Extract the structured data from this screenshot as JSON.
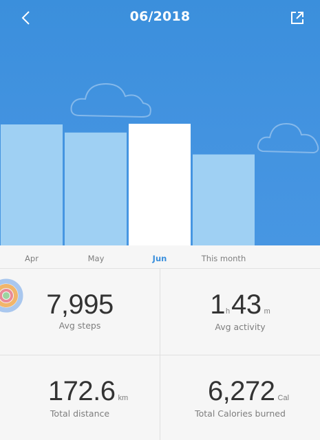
{
  "header": {
    "title": "06/2018",
    "back_icon": "chevron-left-icon",
    "share_icon": "share-external-icon"
  },
  "chart_data": {
    "type": "bar",
    "categories": [
      "Apr",
      "May",
      "Jun",
      "This month"
    ],
    "values": [
      7020,
      6550,
      7060,
      5280
    ],
    "selected_index": 2,
    "colors": {
      "bar": "#9fd0f3",
      "selected": "#ffffff",
      "background": "#3f91de"
    }
  },
  "tabs": [
    {
      "label": "Apr"
    },
    {
      "label": "May"
    },
    {
      "label": "Jun",
      "active": true
    },
    {
      "label": "This month"
    }
  ],
  "stats": {
    "avg_steps": {
      "value": "7,995",
      "label": "Avg steps"
    },
    "avg_activity": {
      "hours": "1",
      "hours_unit": "h",
      "minutes": "43",
      "minutes_unit": "m",
      "label": "Avg activity"
    },
    "total_distance": {
      "value": "172.6",
      "unit": "km",
      "label": "Total distance"
    },
    "total_calories": {
      "value": "6,272",
      "unit": "Cal",
      "label": "Total Calories burned"
    }
  },
  "accent_color": "#3a8fdc"
}
